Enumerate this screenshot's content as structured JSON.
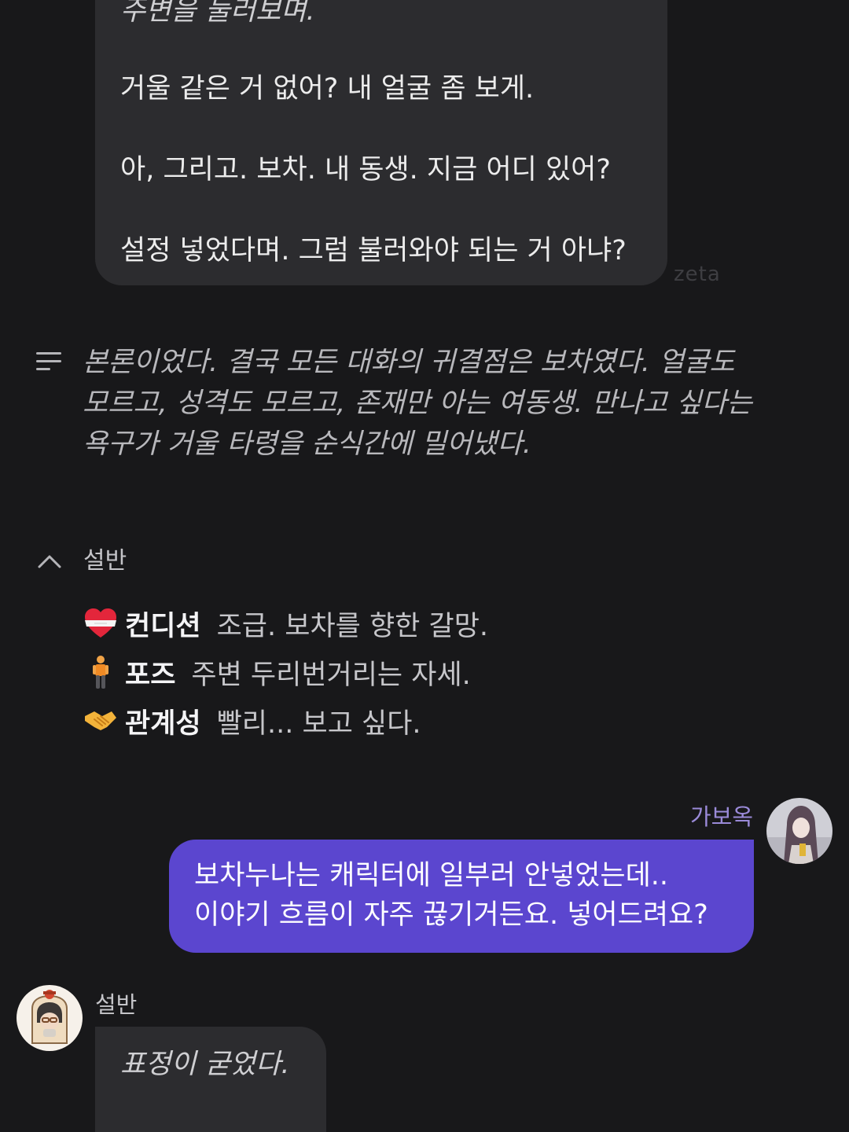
{
  "top_message": {
    "lines": [
      {
        "text": "주변을 둘러보며.",
        "style": "italic"
      },
      {
        "text": "거울 같은 거 없어? 내 얼굴 좀 보게.",
        "style": "normal"
      },
      {
        "text": "아, 그리고. 보차. 내 동생. 지금 어디 있어?",
        "style": "normal"
      },
      {
        "text": "설정 넣었다며. 그럼 불러와야 되는 거 아냐?",
        "style": "normal"
      }
    ],
    "watermark": "zeta"
  },
  "summary": {
    "icon": "text-lines-icon",
    "lines": [
      "본론이었다. 결국 모든 대화의 귀결점은 보차였다. 얼굴도",
      "모르고, 성격도 모르고, 존재만 아는 여동생. 만나고 싶다는",
      "욕구가 거울 타령을 순식간에 밀어냈다."
    ]
  },
  "status": {
    "collapse_icon": "chevron-up-icon",
    "title": "설반",
    "rows": [
      {
        "icon": "bandaged-heart-icon",
        "key": "컨디션",
        "value": "조급. 보차를 향한 갈망."
      },
      {
        "icon": "standing-person-icon",
        "key": "포즈",
        "value": "주변 두리번거리는 자세."
      },
      {
        "icon": "handshake-icon",
        "key": "관계성",
        "value": "빨리... 보고 싶다."
      }
    ]
  },
  "user_message": {
    "name": "가보옥",
    "avatar": "user-avatar",
    "lines": [
      "보차누나는 캐릭터에 일부러 안넣었는데..",
      "이야기 흐름이 자주 끊기거든요. 넣어드려요?"
    ]
  },
  "bottom_message": {
    "name": "설반",
    "avatar": "character-avatar",
    "first_line": "표정이 굳었다."
  },
  "colors": {
    "background": "#18181a",
    "ai_bubble": "#2c2c2f",
    "user_bubble": "#5b46cf",
    "user_name": "#9a8ad8"
  }
}
